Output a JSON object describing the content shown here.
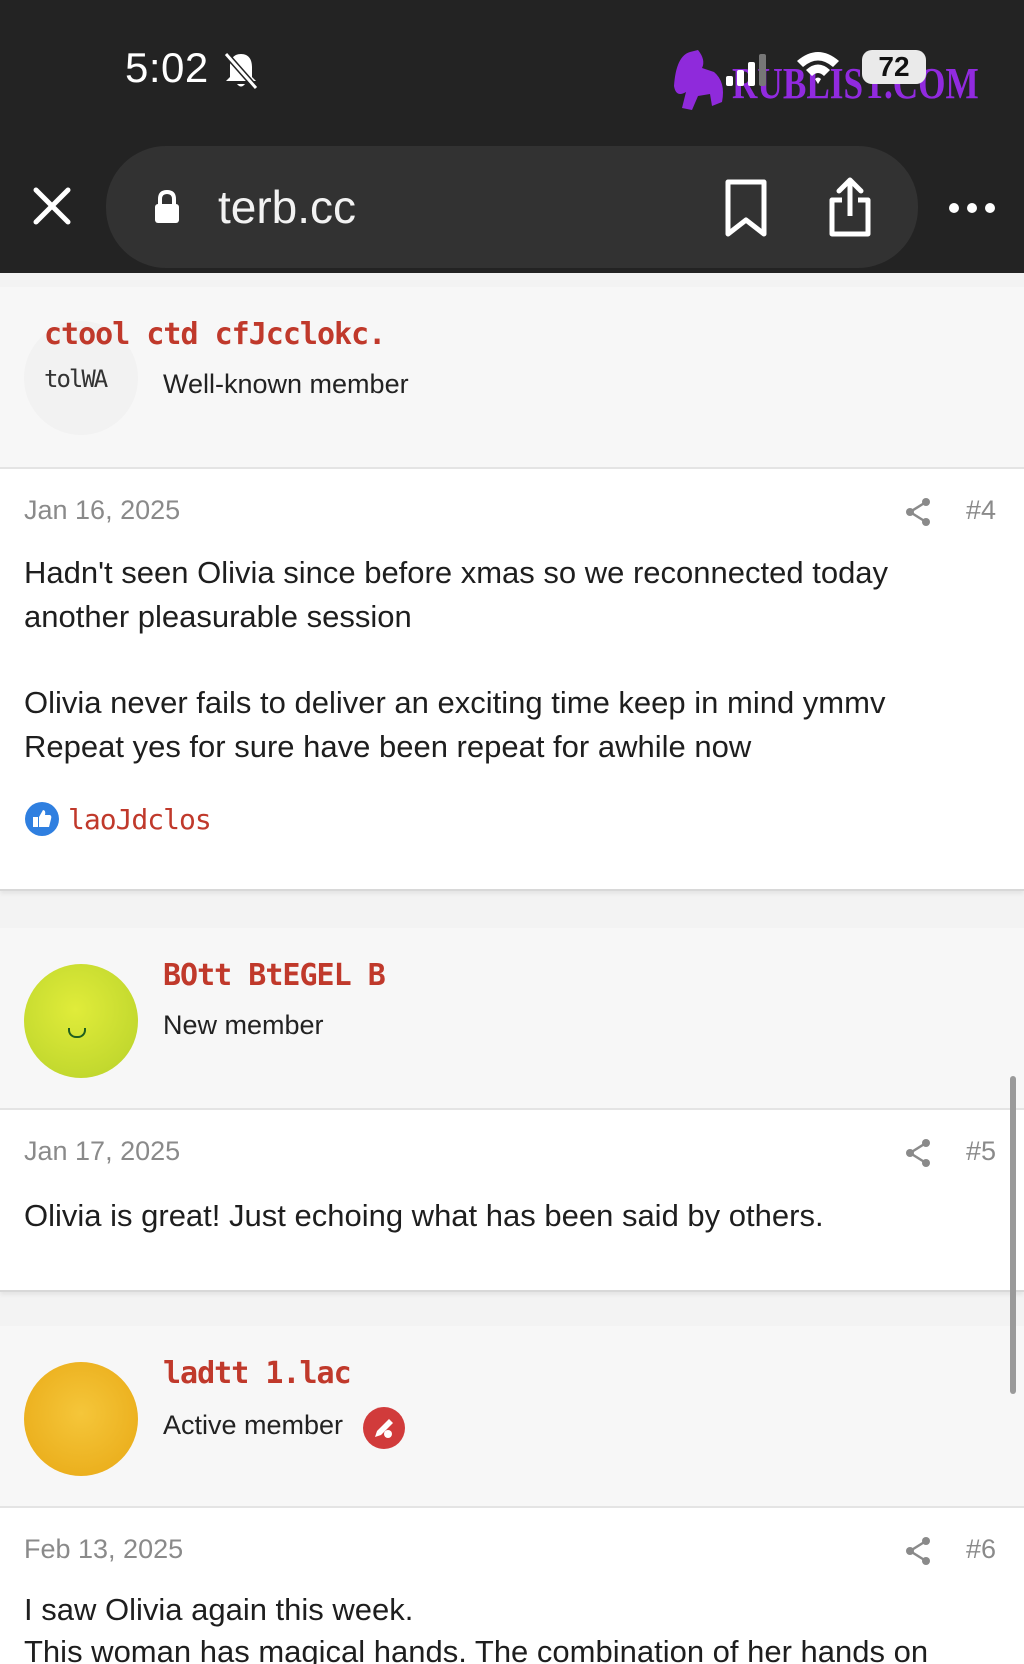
{
  "status_bar": {
    "time": "5:02",
    "battery": "72",
    "watermark": "RUBLIST.COM"
  },
  "browser": {
    "url": "terb.cc",
    "close_icon": "close-icon",
    "lock_icon": "lock-icon",
    "bookmark_icon": "bookmark-icon",
    "share_icon": "share-icon",
    "more_icon": "more-icon"
  },
  "posts": [
    {
      "username": "ctool ctd cfJcclokc.",
      "avatar_initials": "tolWA",
      "user_title": "Well-known member",
      "date": "Jan 16, 2025",
      "number": "#4",
      "lines": [
        "Hadn't seen Olivia since before xmas so we reconnected today",
        "another pleasurable session",
        "",
        "Olivia never fails to deliver an exciting time keep in mind ymmv",
        "Repeat yes for sure have been repeat for awhile now"
      ],
      "reaction": "laoJdclos"
    },
    {
      "username": "BOtt BtEGEL  B",
      "user_title": "New member",
      "date": "Jan 17, 2025",
      "number": "#5",
      "lines": [
        "Olivia is great! Just echoing what has been said by others."
      ]
    },
    {
      "username": "ladtt 1.lac",
      "user_title": "Active member",
      "date": "Feb 13, 2025",
      "number": "#6",
      "lines": [
        "I saw Olivia again this week.",
        "This woman has magical hands. The combination of her hands on"
      ]
    }
  ],
  "colors": {
    "chrome_bg": "#232323",
    "urlbar_bg": "#323232",
    "username": "#c0392b",
    "watermark": "#9b2bf0",
    "like_blue": "#2f7fe0"
  }
}
